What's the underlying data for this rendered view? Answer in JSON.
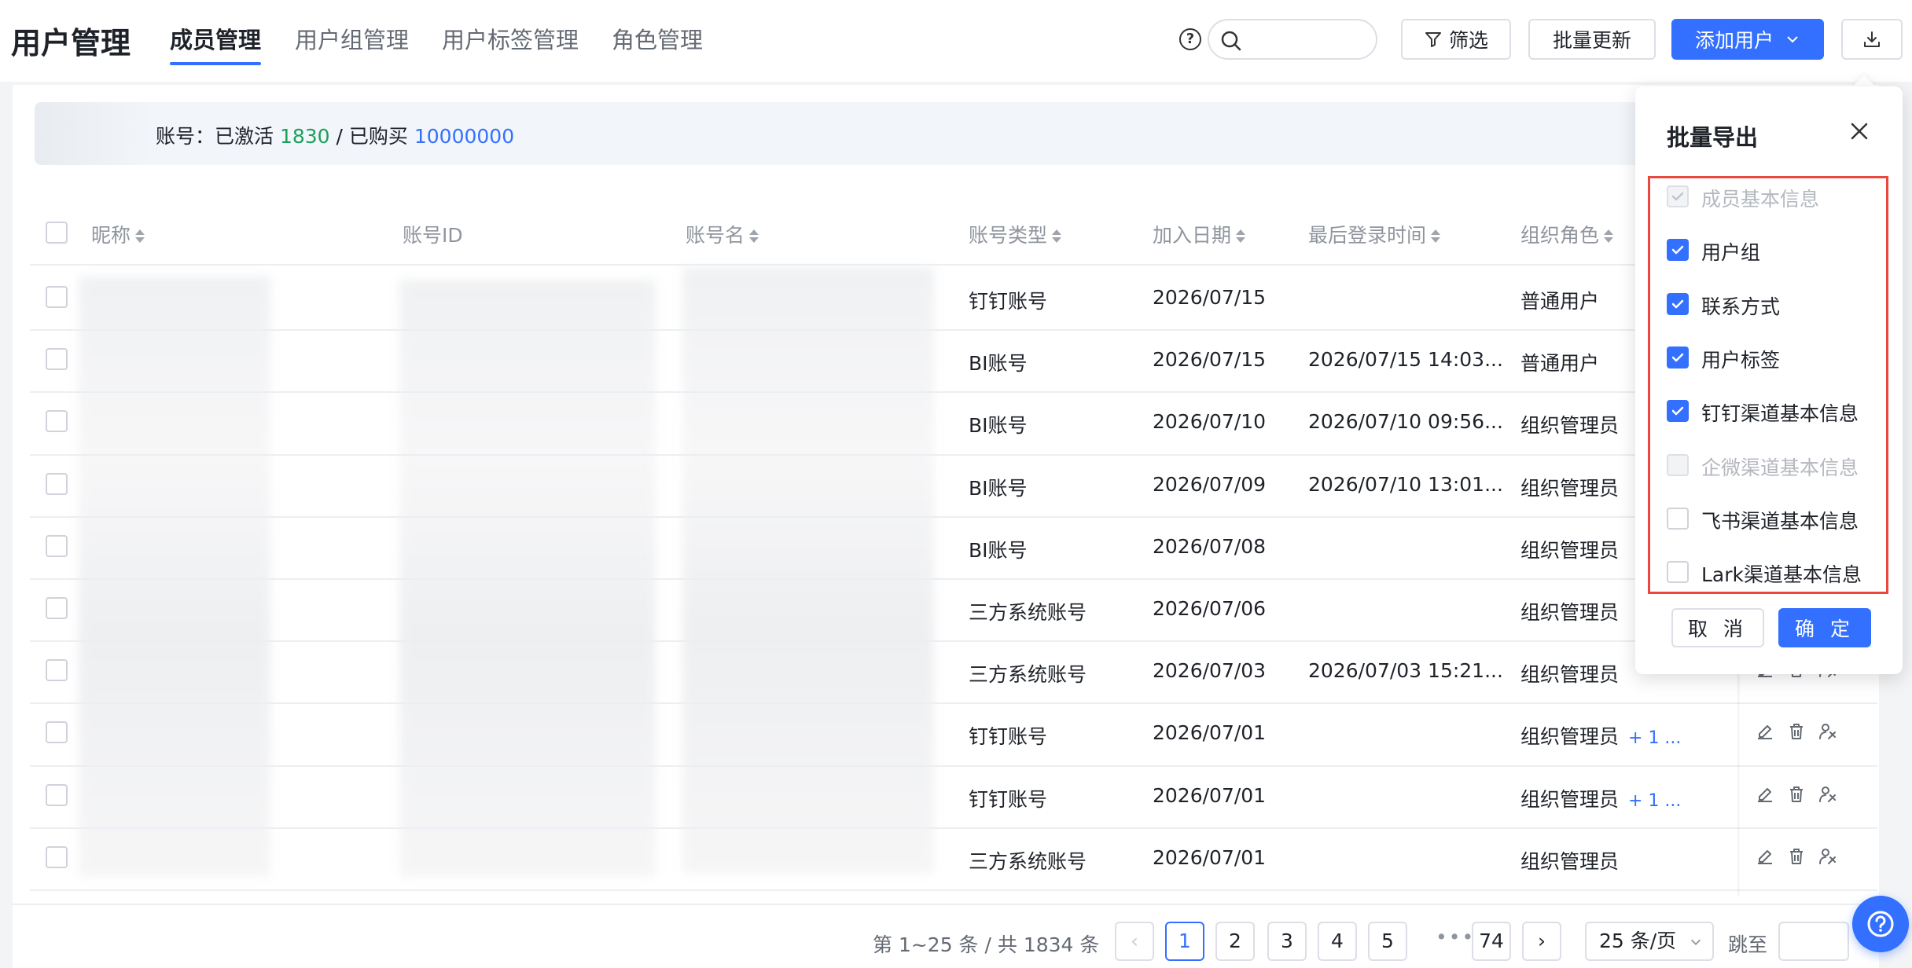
{
  "header": {
    "title": "用户管理",
    "tabs": [
      "成员管理",
      "用户组管理",
      "用户标签管理",
      "角色管理"
    ],
    "active_tab": "成员管理",
    "filter_label": "筛选",
    "batch_update_label": "批量更新",
    "add_user_label": "添加用户"
  },
  "account_info": {
    "prefix": "账号：已激活",
    "activated": "1830",
    "separator": " / 已购买 ",
    "purchased": "10000000"
  },
  "table": {
    "columns": [
      "昵称",
      "账号ID",
      "账号名",
      "账号类型",
      "加入日期",
      "最后登录时间",
      "组织角色"
    ],
    "rows": [
      {
        "type": "钉钉账号",
        "date": "2026/07/15",
        "last_login": "",
        "role": "普通用户",
        "more": ""
      },
      {
        "type": "BI账号",
        "date": "2026/07/15",
        "last_login": "2026/07/15 14:03...",
        "role": "普通用户",
        "more": ""
      },
      {
        "type": "BI账号",
        "date": "2026/07/10",
        "last_login": "2026/07/10 09:56...",
        "role": "组织管理员",
        "more": ""
      },
      {
        "type": "BI账号",
        "date": "2026/07/09",
        "last_login": "2026/07/10 13:01...",
        "role": "组织管理员",
        "more": ""
      },
      {
        "type": "BI账号",
        "date": "2026/07/08",
        "last_login": "",
        "role": "组织管理员",
        "more": ""
      },
      {
        "type": "三方系统账号",
        "date": "2026/07/06",
        "last_login": "",
        "role": "组织管理员",
        "more": ""
      },
      {
        "type": "三方系统账号",
        "date": "2026/07/03",
        "last_login": "2026/07/03 15:21...",
        "role": "组织管理员",
        "more": ""
      },
      {
        "type": "钉钉账号",
        "date": "2026/07/01",
        "last_login": "",
        "role": "组织管理员",
        "more": "+ 1 ..."
      },
      {
        "type": "钉钉账号",
        "date": "2026/07/01",
        "last_login": "",
        "role": "组织管理员",
        "more": "+ 1 ..."
      },
      {
        "type": "三方系统账号",
        "date": "2026/07/01",
        "last_login": "",
        "role": "组织管理员",
        "more": ""
      }
    ]
  },
  "pagination": {
    "summary": "第 1~25 条 / 共 1834 条",
    "pages": [
      "1",
      "2",
      "3",
      "4",
      "5"
    ],
    "last_page": "74",
    "current": "1",
    "ellipsis": "•••",
    "page_size": "25 条/页",
    "jump_label": "跳至"
  },
  "export_popover": {
    "title": "批量导出",
    "options": [
      {
        "label": "成员基本信息",
        "checked": true,
        "disabled": true
      },
      {
        "label": "用户组",
        "checked": true,
        "disabled": false
      },
      {
        "label": "联系方式",
        "checked": true,
        "disabled": false
      },
      {
        "label": "用户标签",
        "checked": true,
        "disabled": false
      },
      {
        "label": "钉钉渠道基本信息",
        "checked": true,
        "disabled": false
      },
      {
        "label": "企微渠道基本信息",
        "checked": false,
        "disabled": true
      },
      {
        "label": "飞书渠道基本信息",
        "checked": false,
        "disabled": false
      },
      {
        "label": "Lark渠道基本信息",
        "checked": false,
        "disabled": false
      }
    ],
    "cancel_label": "取 消",
    "ok_label": "确 定"
  },
  "colors": {
    "primary": "#3370ff",
    "activated_green": "#1aa05a",
    "highlight_red": "#e8483e"
  },
  "icons": [
    "help-icon",
    "search-icon",
    "filter-icon",
    "chevron-down-icon",
    "download-icon",
    "close-icon",
    "edit-icon",
    "delete-icon",
    "user-permission-icon"
  ]
}
